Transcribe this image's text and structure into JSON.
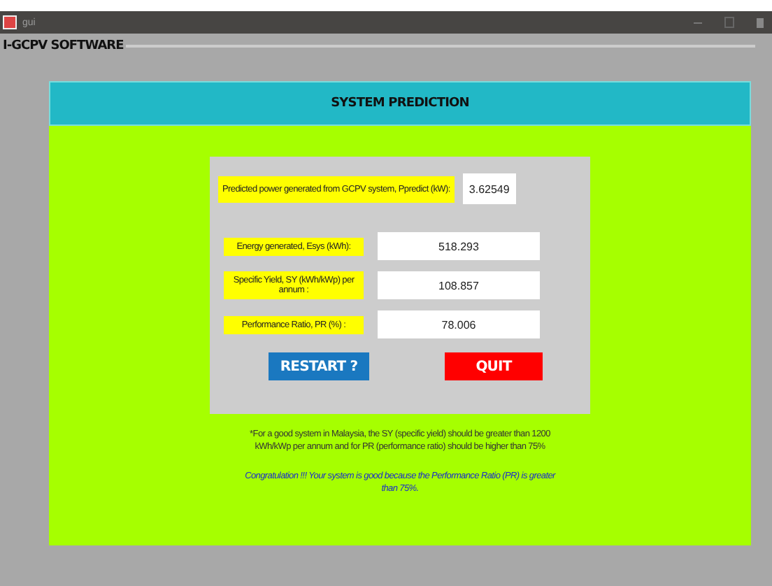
{
  "window": {
    "title": "gui"
  },
  "menu": {
    "title": "I-GCPV SOFTWARE"
  },
  "header": {
    "title": "SYSTEM PREDICTION"
  },
  "outputs": [
    {
      "kind": "wide",
      "label": "Predicted power generated from GCPV system, Ppredict (kW):",
      "value": "3.62549"
    },
    {
      "kind": "row",
      "label": "Energy generated, Esys (kWh):",
      "value": "518.293"
    },
    {
      "kind": "row",
      "label": "Specific Yield, SY (kWh/kWp) per annum :",
      "value": "108.857"
    },
    {
      "kind": "row",
      "label": "Performance Ratio, PR (%) :",
      "value": "78.006"
    }
  ],
  "buttons": [
    {
      "label": "RESTART ?",
      "kind": "restart"
    },
    {
      "label": "QUIT",
      "kind": "quit"
    }
  ],
  "note": "*For a good system in Malaysia, the SY (specific yield) should be greater than 1200 kWh/kWp per annum and for PR (performance ratio) should be higher than 75%",
  "result": "Congratulation !!! Your system is good because the Performance Ratio (PR) is greater than 75%."
}
